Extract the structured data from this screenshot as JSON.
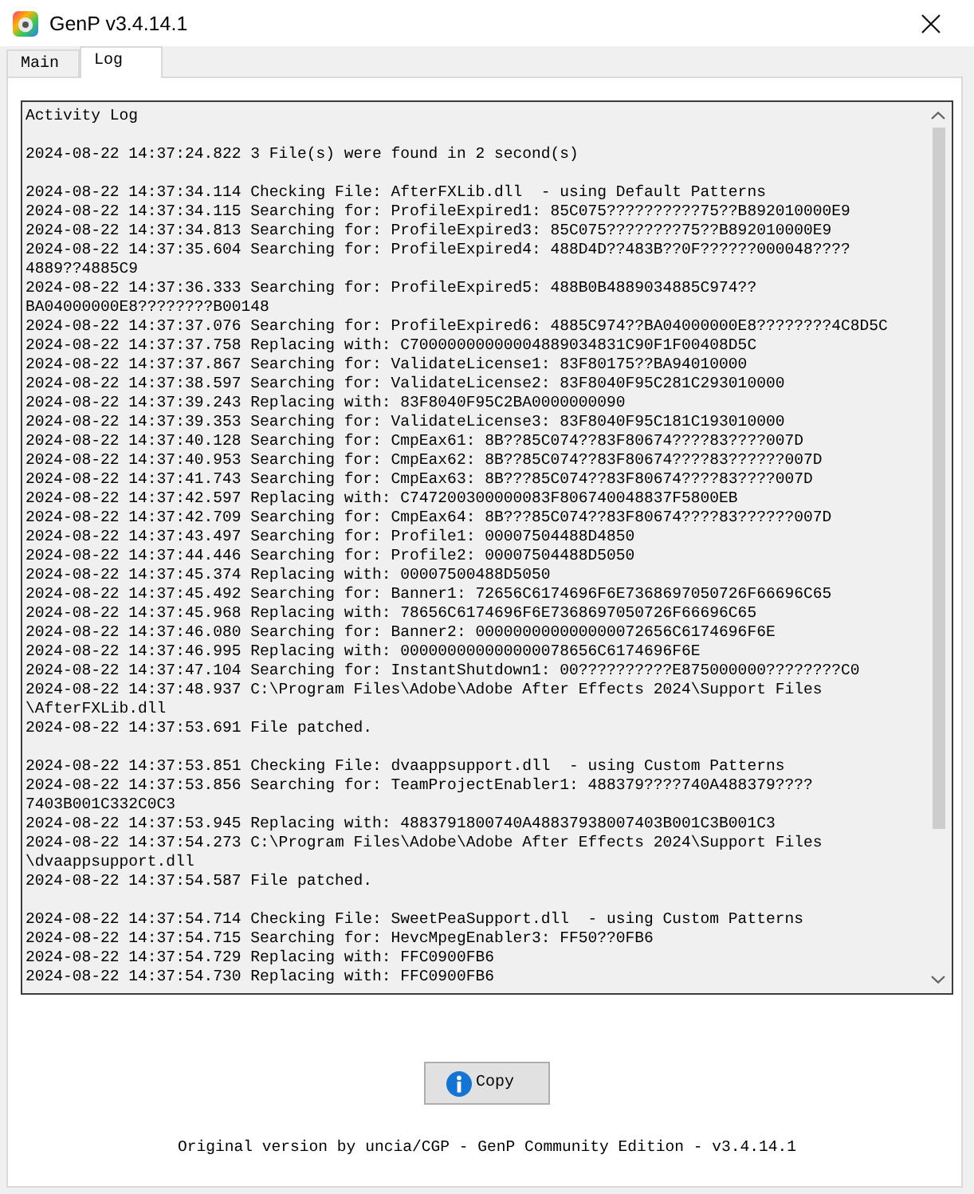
{
  "window": {
    "title": "GenP v3.4.14.1"
  },
  "tabs": [
    {
      "label": "Main",
      "selected": false
    },
    {
      "label": "Log",
      "selected": true
    }
  ],
  "log": {
    "paragraphs": [
      [
        "Activity Log"
      ],
      [
        "2024-08-22 14:37:24.822 3 File(s) were found in 2 second(s)"
      ],
      [
        "2024-08-22 14:37:34.114 Checking File: AfterFXLib.dll  - using Default Patterns",
        "2024-08-22 14:37:34.115 Searching for: ProfileExpired1: 85C075??????????75??B892010000E9",
        "2024-08-22 14:37:34.813 Searching for: ProfileExpired3: 85C075????????75??B892010000E9",
        "2024-08-22 14:37:35.604 Searching for: ProfileExpired4: 488D4D??483B??0F??????000048????",
        "4889??4885C9",
        "2024-08-22 14:37:36.333 Searching for: ProfileExpired5: 488B0B4889034885C974??",
        "BA04000000E8????????B00148",
        "2024-08-22 14:37:37.076 Searching for: ProfileExpired6: 4885C974??BA04000000E8????????4C8D5C",
        "2024-08-22 14:37:37.758 Replacing with: C70000000000004889034831C90F1F00408D5C",
        "2024-08-22 14:37:37.867 Searching for: ValidateLicense1: 83F80175??BA94010000",
        "2024-08-22 14:37:38.597 Searching for: ValidateLicense2: 83F8040F95C281C293010000",
        "2024-08-22 14:37:39.243 Replacing with: 83F8040F95C2BA0000000090",
        "2024-08-22 14:37:39.353 Searching for: ValidateLicense3: 83F8040F95C181C193010000",
        "2024-08-22 14:37:40.128 Searching for: CmpEax61: 8B??85C074??83F80674????83????007D",
        "2024-08-22 14:37:40.953 Searching for: CmpEax62: 8B??85C074??83F80674????83??????007D",
        "2024-08-22 14:37:41.743 Searching for: CmpEax63: 8B???85C074??83F80674????83????007D",
        "2024-08-22 14:37:42.597 Replacing with: C747200300000083F806740048837F5800EB",
        "2024-08-22 14:37:42.709 Searching for: CmpEax64: 8B???85C074??83F80674????83??????007D",
        "2024-08-22 14:37:43.497 Searching for: Profile1: 00007504488D4850",
        "2024-08-22 14:37:44.446 Searching for: Profile2: 00007504488D5050",
        "2024-08-22 14:37:45.374 Replacing with: 00007500488D5050",
        "2024-08-22 14:37:45.492 Searching for: Banner1: 72656C6174696F6E7368697050726F66696C65",
        "2024-08-22 14:37:45.968 Replacing with: 78656C6174696F6E7368697050726F66696C65",
        "2024-08-22 14:37:46.080 Searching for: Banner2: 000000000000000072656C6174696F6E",
        "2024-08-22 14:37:46.995 Replacing with: 000000000000000078656C6174696F6E",
        "2024-08-22 14:37:47.104 Searching for: InstantShutdown1: 00??????????E875000000????????C0",
        "2024-08-22 14:37:48.937 C:\\Program Files\\Adobe\\Adobe After Effects 2024\\Support Files",
        "\\AfterFXLib.dll",
        "2024-08-22 14:37:53.691 File patched."
      ],
      [
        "2024-08-22 14:37:53.851 Checking File: dvaappsupport.dll  - using Custom Patterns",
        "2024-08-22 14:37:53.856 Searching for: TeamProjectEnabler1: 488379????740A488379????",
        "7403B001C332C0C3",
        "2024-08-22 14:37:53.945 Replacing with: 4883791800740A48837938007403B001C3B001C3",
        "2024-08-22 14:37:54.273 C:\\Program Files\\Adobe\\Adobe After Effects 2024\\Support Files",
        "\\dvaappsupport.dll",
        "2024-08-22 14:37:54.587 File patched."
      ],
      [
        "2024-08-22 14:37:54.714 Checking File: SweetPeaSupport.dll  - using Custom Patterns",
        "2024-08-22 14:37:54.715 Searching for: HevcMpegEnabler3: FF50??0FB6",
        "2024-08-22 14:37:54.729 Replacing with: FFC0900FB6",
        "2024-08-22 14:37:54.730 Replacing with: FFC0900FB6"
      ]
    ]
  },
  "copy_button": {
    "label": "Copy"
  },
  "footer": "Original version by uncia/CGP - GenP Community Edition - v3.4.14.1"
}
